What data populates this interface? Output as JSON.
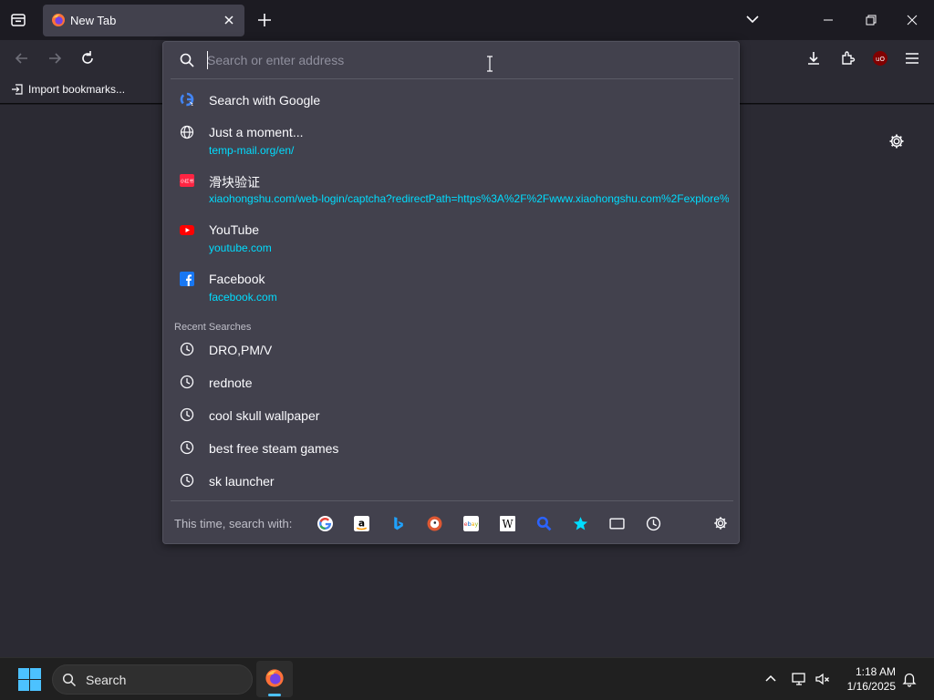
{
  "tab": {
    "title": "New Tab"
  },
  "bookmarks": {
    "import_label": "Import bookmarks..."
  },
  "urlbar": {
    "placeholder": "Search or enter address",
    "search_with_google": "Search with Google",
    "results": [
      {
        "title": "Just a moment...",
        "url": "temp-mail.org/en/",
        "icon": "globe-icon"
      },
      {
        "title": "滑块验证",
        "url": "xiaohongshu.com/web-login/captcha?redirectPath=https%3A%2F%2Fwww.xiaohongshu.com%2Fexplore%",
        "icon": "xiaohongshu-icon"
      },
      {
        "title": "YouTube",
        "url": "youtube.com",
        "icon": "youtube-icon"
      },
      {
        "title": "Facebook",
        "url": "facebook.com",
        "icon": "facebook-icon"
      }
    ],
    "recent_label": "Recent Searches",
    "recent": [
      "DRO,PM/V",
      "rednote",
      "cool skull wallpaper",
      "best free steam games",
      "sk launcher"
    ],
    "footer_label": "This time, search with:",
    "engines": [
      "google-icon",
      "amazon-icon",
      "bing-icon",
      "duckduckgo-icon",
      "ebay-icon",
      "wikipedia-icon",
      "search-engine-icon",
      "bookmarks-star-icon",
      "tabs-icon",
      "history-clock-icon"
    ]
  },
  "taskbar": {
    "search_label": "Search",
    "time": "1:18 AM",
    "date": "1/16/2025"
  },
  "colors": {
    "accent_url": "#00ddff",
    "panel": "#42414d",
    "toolbar": "#2b2a33"
  }
}
